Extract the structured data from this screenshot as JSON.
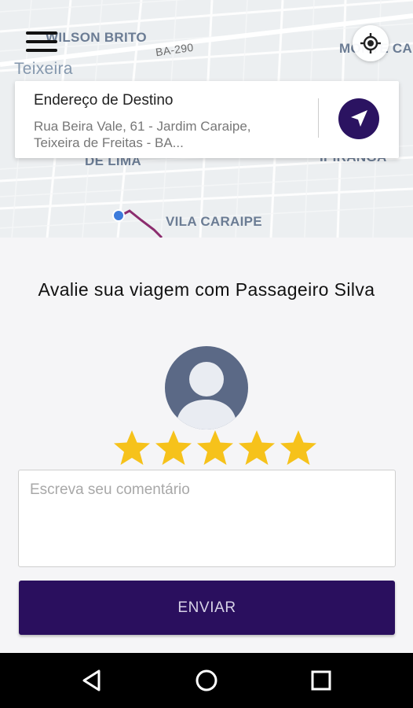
{
  "map": {
    "labels": {
      "wilson_brito": "WILSON BRITO",
      "ba290": "BA-290",
      "monte_ca": "MONTE CA",
      "teixeira": "Teixeira",
      "de_lima": "DE LIMA",
      "ipiranga": "IPIRANGA",
      "vila_caraipe": "VILA CARAIPE"
    },
    "route_color": "#8b2c6e",
    "origin_dot_color": "#3d7bdb"
  },
  "destination": {
    "title": "Endereço de Destino",
    "address": "Rua Beira Vale, 61 - Jardim Caraipe, Teixeira de Freitas - BA..."
  },
  "rating": {
    "title": "Avalie sua viagem com Passageiro Silva",
    "stars": 5,
    "max_stars": 5,
    "star_color": "#f6c21b",
    "comment_placeholder": "Escreva seu comentário",
    "submit_label": "ENVIAR"
  },
  "colors": {
    "accent": "#2a0f5e",
    "avatar_bg": "#5b6986"
  },
  "system_nav": {
    "back": "back-icon",
    "home": "home-icon",
    "recents": "recents-icon"
  }
}
